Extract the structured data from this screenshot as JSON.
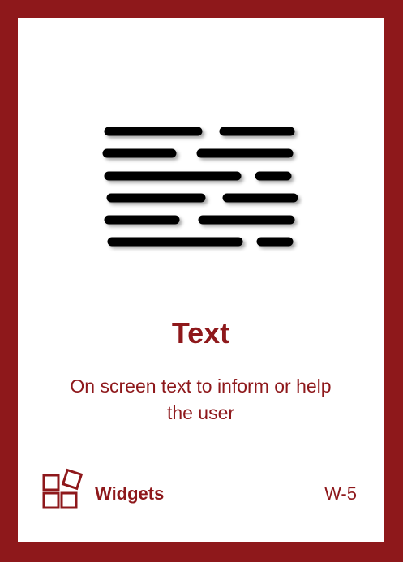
{
  "card": {
    "title": "Text",
    "description": "On screen text to inform or help the user",
    "category": "Widgets",
    "code": "W-5"
  },
  "icons": {
    "illustration": "text-lines-icon",
    "category": "widgets-icon"
  },
  "colors": {
    "accent": "#8e181b",
    "background": "#ffffff",
    "illustration": "#000000"
  }
}
